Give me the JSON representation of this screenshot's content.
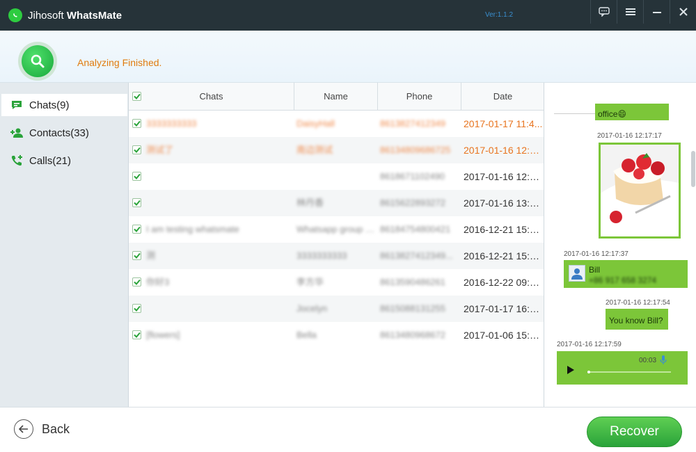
{
  "app": {
    "title_prefix": "Jihosoft ",
    "title_bold": "WhatsMate",
    "version": "Ver:1.1.2",
    "window_buttons": [
      "feedback-icon",
      "menu-icon",
      "minimize-icon",
      "close-icon"
    ]
  },
  "status": {
    "text": "Analyzing Finished.",
    "color": "#e07b0e"
  },
  "sidebar": {
    "items": [
      {
        "label": "Chats(9)",
        "icon": "chat-icon",
        "active": true
      },
      {
        "label": "Contacts(33)",
        "icon": "add-contact-icon",
        "active": false
      },
      {
        "label": "Calls(21)",
        "icon": "phone-icon",
        "active": false
      }
    ]
  },
  "table": {
    "columns": [
      "Chats",
      "Name",
      "Phone",
      "Date"
    ],
    "rows": [
      {
        "chat": "3333333333",
        "name": "DaisyHall",
        "phone": "8613827412349",
        "date": "2017-01-17 11:4...",
        "highlight": true
      },
      {
        "chat": "测试了",
        "name": "南边测试",
        "phone": "86134809686725",
        "date": "2017-01-16 12:1...",
        "highlight": true
      },
      {
        "chat": "",
        "name": "",
        "phone": "8618671102490",
        "date": "2017-01-16 12:1...",
        "highlight": false
      },
      {
        "chat": "",
        "name": "林丹香",
        "phone": "8615622893272",
        "date": "2017-01-16 13:5...",
        "highlight": false
      },
      {
        "chat": "I am testing whatsmate",
        "name": "Whatsapp group c...",
        "phone": "86184754800421",
        "date": "2016-12-21 15:2...",
        "highlight": false
      },
      {
        "chat": "测",
        "name": "3333333333",
        "phone": "8613827412349...",
        "date": "2016-12-21 15:2...",
        "highlight": false
      },
      {
        "chat": "你好3",
        "name": "李方华",
        "phone": "8613590486261",
        "date": "2016-12-22 09:1...",
        "highlight": false
      },
      {
        "chat": "",
        "name": "Jocelyn",
        "phone": "8615088131255",
        "date": "2017-01-17 16:2...",
        "highlight": false
      },
      {
        "chat": "[flowers]",
        "name": "Bella",
        "phone": "8613480968672",
        "date": "2017-01-06 15:0...",
        "highlight": false
      }
    ]
  },
  "preview": {
    "partial_text": "office😄",
    "messages": [
      {
        "time": "2017-01-16 12:17:17",
        "type": "image"
      },
      {
        "time": "2017-01-16 12:17:37",
        "type": "contact",
        "contact_name": "Bill",
        "contact_phone": "+86 917 658 3274"
      },
      {
        "time": "2017-01-16 12:17:54",
        "type": "text",
        "text": "You know Bill?"
      },
      {
        "time": "2017-01-16 12:17:59",
        "type": "audio",
        "duration": "00:03"
      }
    ]
  },
  "bottom": {
    "back_label": "Back",
    "recover_label": "Recover"
  },
  "colors": {
    "titlebar": "#263339",
    "accent_green": "#2aa33a",
    "bubble_green": "#7cc639",
    "highlight_orange": "#e8741f"
  }
}
